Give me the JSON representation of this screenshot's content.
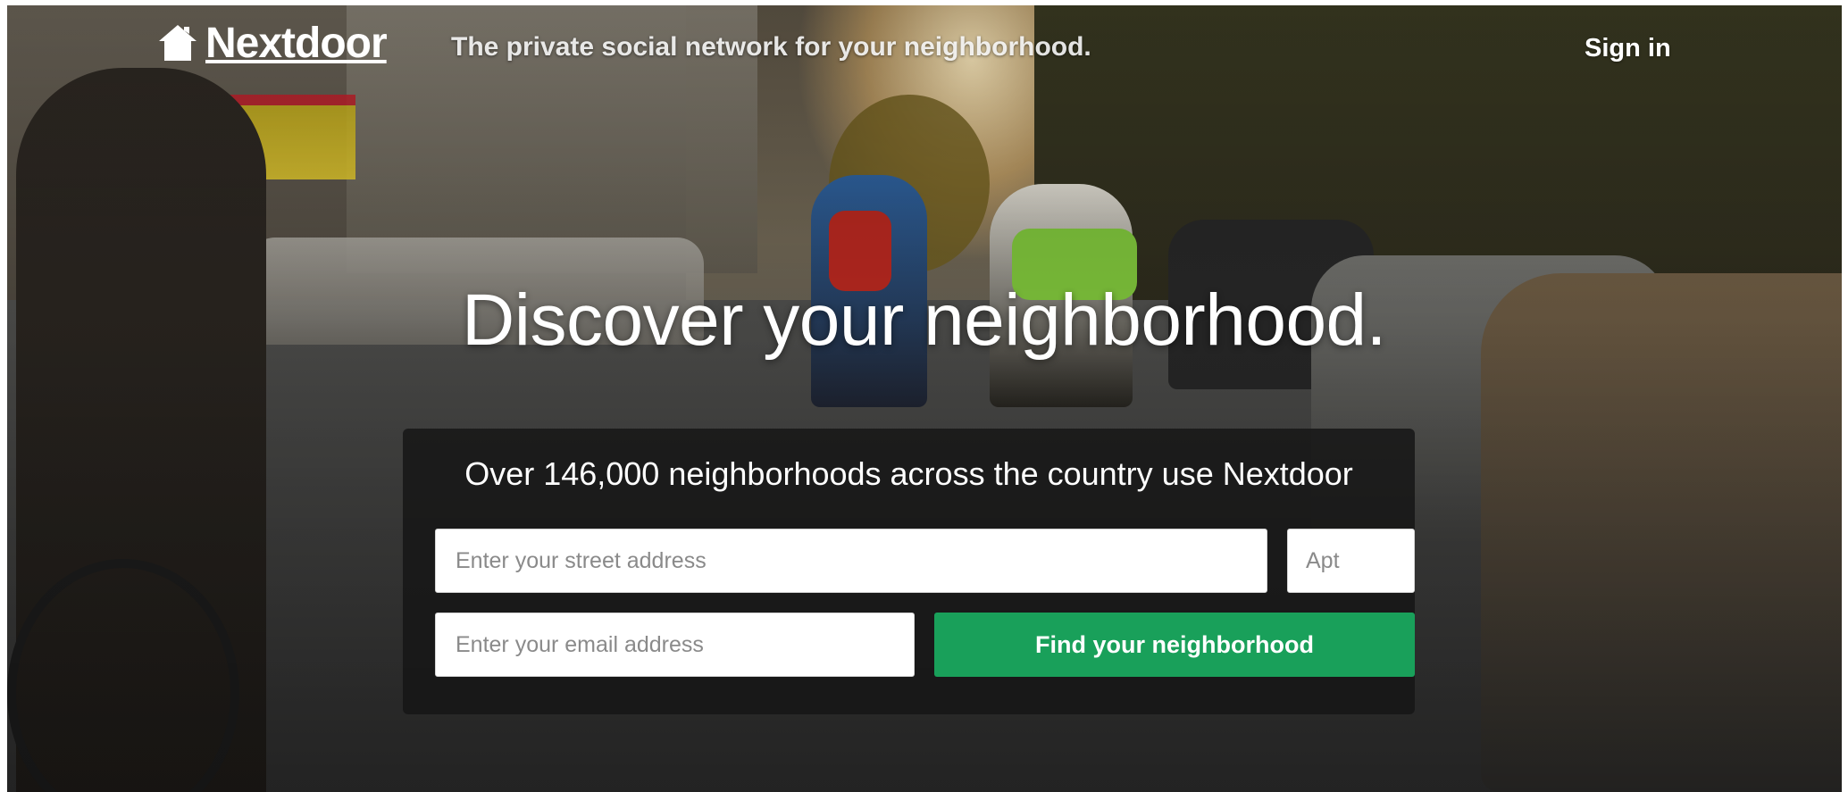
{
  "header": {
    "logo_text": "Nextdoor",
    "logo_icon": "house-icon",
    "tagline": "The private social network for your neighborhood.",
    "signin_label": "Sign in"
  },
  "hero": {
    "headline": "Discover your neighborhood."
  },
  "signup_panel": {
    "title": "Over 146,000 neighborhoods across the country use Nextdoor",
    "street_placeholder": "Enter your street address",
    "apt_placeholder": "Apt",
    "email_placeholder": "Enter your email address",
    "submit_label": "Find your neighborhood"
  },
  "colors": {
    "button_green": "#19a05a",
    "panel_bg": "#161616",
    "text_white": "#ffffff"
  }
}
